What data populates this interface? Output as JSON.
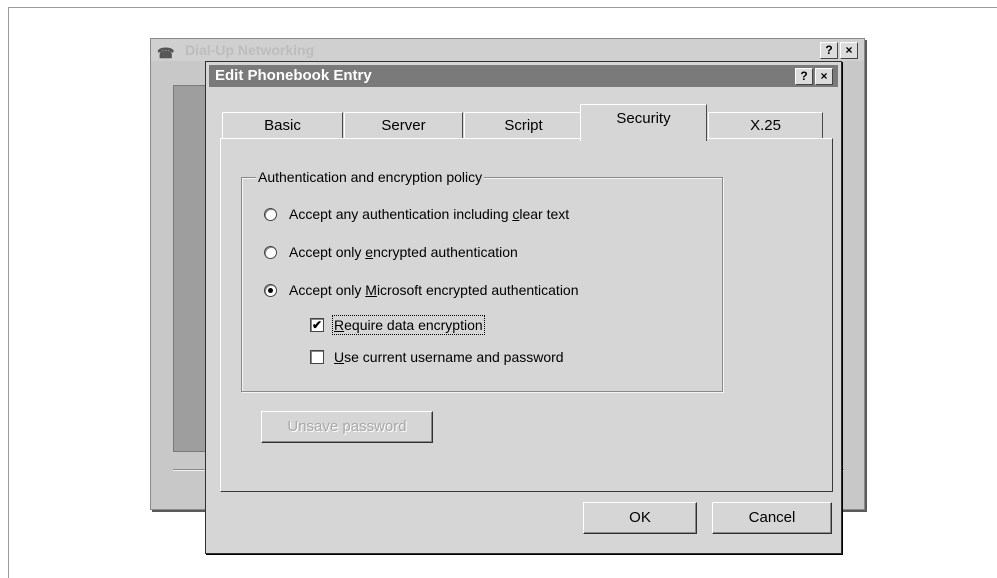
{
  "back_window": {
    "title": "Dial-Up Networking",
    "help_label": "?",
    "close_label": "×"
  },
  "dialog": {
    "title": "Edit Phonebook Entry",
    "help_label": "?",
    "close_label": "×"
  },
  "tabs": [
    {
      "label": "Basic",
      "active": false
    },
    {
      "label": "Server",
      "active": false
    },
    {
      "label": "Script",
      "active": false
    },
    {
      "label": "Security",
      "active": true
    },
    {
      "label": "X.25",
      "active": false
    }
  ],
  "security": {
    "group_label": "Authentication and encryption policy",
    "options": [
      {
        "pre": "Accept any authentication including ",
        "u": "c",
        "post": "lear text",
        "selected": false
      },
      {
        "pre": "Accept only ",
        "u": "e",
        "post": "ncrypted authentication",
        "selected": false
      },
      {
        "pre": "Accept only ",
        "u": "M",
        "post": "icrosoft encrypted authentication",
        "selected": true
      }
    ],
    "require_encryption": {
      "u": "R",
      "post": "equire data encryption",
      "checked": true,
      "check_mark": "✔"
    },
    "use_current": {
      "u": "U",
      "post": "se current username and password",
      "checked": false
    },
    "unsave_label": "Unsave password"
  },
  "buttons": {
    "ok_label": "OK",
    "cancel_label": "Cancel"
  }
}
